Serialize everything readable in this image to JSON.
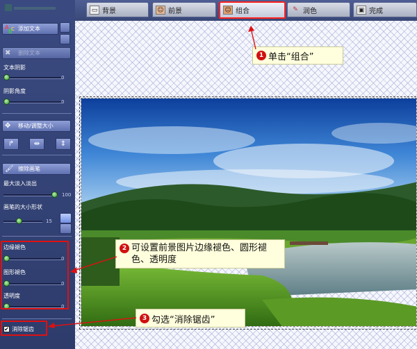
{
  "tabs": [
    {
      "label": "背景",
      "icon": "image-icon"
    },
    {
      "label": "前景",
      "icon": "portrait-icon"
    },
    {
      "label": "组合",
      "icon": "combine-icon"
    },
    {
      "label": "润色",
      "icon": "brush-icon"
    },
    {
      "label": "完成",
      "icon": "monitor-icon"
    }
  ],
  "left": {
    "add_text": "添加文本",
    "delete_text": "删除文本",
    "text_shadow": "文本阴影",
    "text_shadow_value": "0",
    "shadow_angle": "阴影角度",
    "shadow_angle_value": "0",
    "move_resize": "移动/调整大小",
    "erase_brush": "擦除画笔",
    "max_fade": "最大淡入淡出",
    "max_fade_value": "100",
    "brush_size": "画笔的大小形状",
    "brush_size_value": "15",
    "edge_feather": "边缘褪色",
    "edge_feather_value": "0",
    "shape_feather": "图形褪色",
    "shape_feather_value": "0",
    "opacity": "透明度",
    "opacity_value": "0",
    "antialias": "消除锯齿",
    "antialias_checked": true
  },
  "callouts": {
    "c1": {
      "num": "1",
      "text": "单击“组合”"
    },
    "c2": {
      "num": "2",
      "text": "可设置前景图片边缘褪色、圆形褪色、透明度"
    },
    "c3": {
      "num": "3",
      "text": "勾选“消除锯齿”"
    }
  },
  "colors": {
    "accent_red": "#e01010",
    "panel": "#33427a",
    "slider_knob": "#3aa33a"
  }
}
